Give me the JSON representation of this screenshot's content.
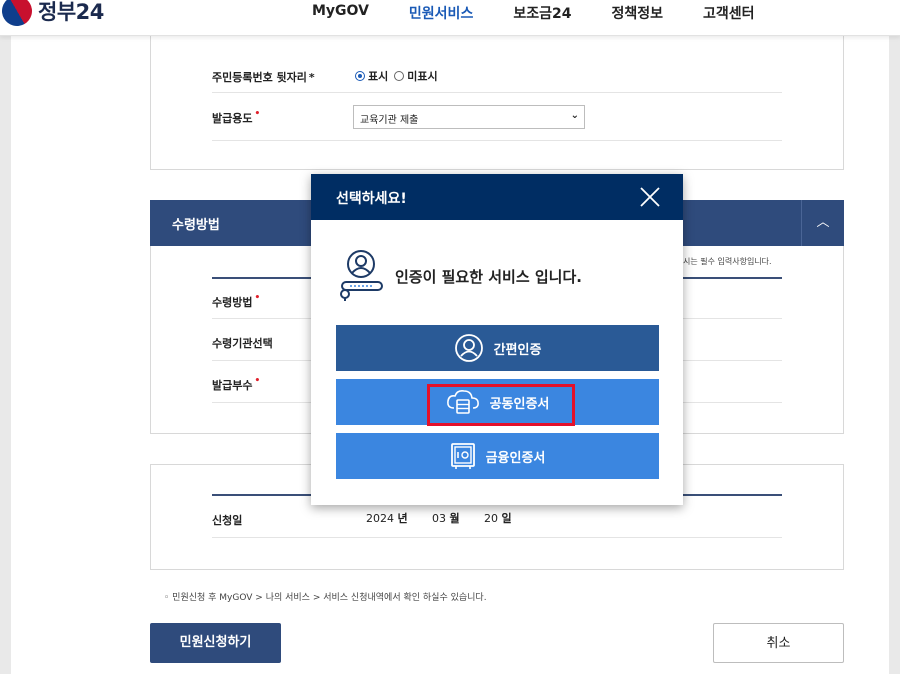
{
  "header": {
    "logo_text": "정부24",
    "nav": [
      "MyGOV",
      "민원서비스",
      "보조금24",
      "정책정보",
      "고객센터"
    ],
    "active_nav": "민원서비스"
  },
  "form1": {
    "ssn_label": "주민등록번호 뒷자리",
    "ssn_required": "*",
    "ssn_options": [
      "표시",
      "미표시"
    ],
    "ssn_selected": "표시",
    "purpose_label": "발급용도",
    "purpose_value": "교육기관 제출",
    "required_mark": "•"
  },
  "section": {
    "title": "수령방법",
    "required_note": "시는 필수 입력사항입니다.",
    "rows": [
      "수령방법",
      "수령기관선택",
      "발급부수"
    ]
  },
  "date_section": {
    "label": "신청일",
    "year": "2024",
    "year_unit": "년",
    "month": "03",
    "month_unit": "월",
    "day": "20",
    "day_unit": "일"
  },
  "footer": {
    "note": "◦ 민원신청 후 MyGOV > 나의 서비스 > 서비스 신청내역에서 확인 하실수 있습니다.",
    "apply_label": "민원신청하기",
    "cancel_label": "취소"
  },
  "modal": {
    "title": "선택하세요!",
    "description": "인증이 필요한 서비스 입니다.",
    "buttons": [
      {
        "label": "간편인증",
        "icon": "person-circle-icon"
      },
      {
        "label": "공동인증서",
        "icon": "cloud-server-icon"
      },
      {
        "label": "금융인증서",
        "icon": "safe-icon"
      }
    ],
    "highlighted": "공동인증서"
  },
  "colors": {
    "navy": "#2f4b7c",
    "modal_header": "#002d63",
    "button_dark": "#2a5a96",
    "button_light": "#3b86e0",
    "highlight": "#e3102a"
  }
}
